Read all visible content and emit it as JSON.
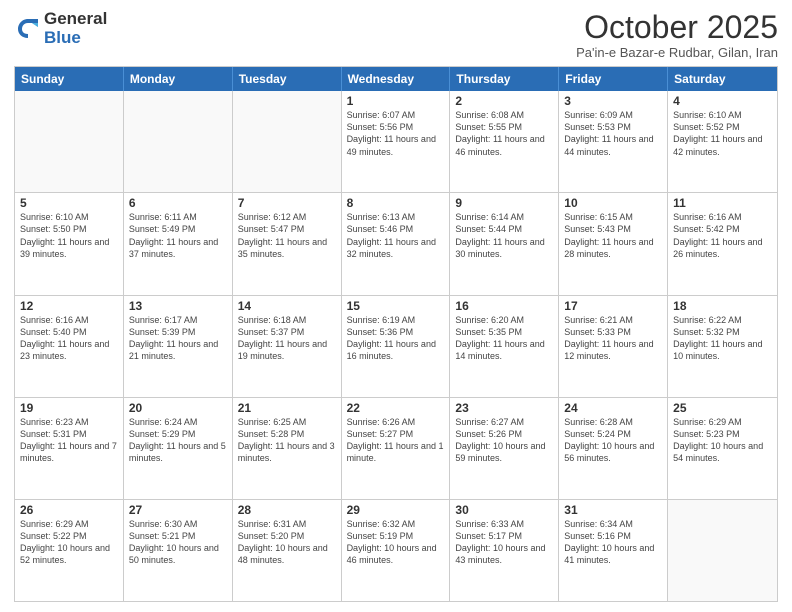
{
  "logo": {
    "general": "General",
    "blue": "Blue"
  },
  "header": {
    "month": "October 2025",
    "location": "Pa'in-e Bazar-e Rudbar, Gilan, Iran"
  },
  "weekdays": [
    "Sunday",
    "Monday",
    "Tuesday",
    "Wednesday",
    "Thursday",
    "Friday",
    "Saturday"
  ],
  "rows": [
    [
      {
        "day": "",
        "info": ""
      },
      {
        "day": "",
        "info": ""
      },
      {
        "day": "",
        "info": ""
      },
      {
        "day": "1",
        "info": "Sunrise: 6:07 AM\nSunset: 5:56 PM\nDaylight: 11 hours and 49 minutes."
      },
      {
        "day": "2",
        "info": "Sunrise: 6:08 AM\nSunset: 5:55 PM\nDaylight: 11 hours and 46 minutes."
      },
      {
        "day": "3",
        "info": "Sunrise: 6:09 AM\nSunset: 5:53 PM\nDaylight: 11 hours and 44 minutes."
      },
      {
        "day": "4",
        "info": "Sunrise: 6:10 AM\nSunset: 5:52 PM\nDaylight: 11 hours and 42 minutes."
      }
    ],
    [
      {
        "day": "5",
        "info": "Sunrise: 6:10 AM\nSunset: 5:50 PM\nDaylight: 11 hours and 39 minutes."
      },
      {
        "day": "6",
        "info": "Sunrise: 6:11 AM\nSunset: 5:49 PM\nDaylight: 11 hours and 37 minutes."
      },
      {
        "day": "7",
        "info": "Sunrise: 6:12 AM\nSunset: 5:47 PM\nDaylight: 11 hours and 35 minutes."
      },
      {
        "day": "8",
        "info": "Sunrise: 6:13 AM\nSunset: 5:46 PM\nDaylight: 11 hours and 32 minutes."
      },
      {
        "day": "9",
        "info": "Sunrise: 6:14 AM\nSunset: 5:44 PM\nDaylight: 11 hours and 30 minutes."
      },
      {
        "day": "10",
        "info": "Sunrise: 6:15 AM\nSunset: 5:43 PM\nDaylight: 11 hours and 28 minutes."
      },
      {
        "day": "11",
        "info": "Sunrise: 6:16 AM\nSunset: 5:42 PM\nDaylight: 11 hours and 26 minutes."
      }
    ],
    [
      {
        "day": "12",
        "info": "Sunrise: 6:16 AM\nSunset: 5:40 PM\nDaylight: 11 hours and 23 minutes."
      },
      {
        "day": "13",
        "info": "Sunrise: 6:17 AM\nSunset: 5:39 PM\nDaylight: 11 hours and 21 minutes."
      },
      {
        "day": "14",
        "info": "Sunrise: 6:18 AM\nSunset: 5:37 PM\nDaylight: 11 hours and 19 minutes."
      },
      {
        "day": "15",
        "info": "Sunrise: 6:19 AM\nSunset: 5:36 PM\nDaylight: 11 hours and 16 minutes."
      },
      {
        "day": "16",
        "info": "Sunrise: 6:20 AM\nSunset: 5:35 PM\nDaylight: 11 hours and 14 minutes."
      },
      {
        "day": "17",
        "info": "Sunrise: 6:21 AM\nSunset: 5:33 PM\nDaylight: 11 hours and 12 minutes."
      },
      {
        "day": "18",
        "info": "Sunrise: 6:22 AM\nSunset: 5:32 PM\nDaylight: 11 hours and 10 minutes."
      }
    ],
    [
      {
        "day": "19",
        "info": "Sunrise: 6:23 AM\nSunset: 5:31 PM\nDaylight: 11 hours and 7 minutes."
      },
      {
        "day": "20",
        "info": "Sunrise: 6:24 AM\nSunset: 5:29 PM\nDaylight: 11 hours and 5 minutes."
      },
      {
        "day": "21",
        "info": "Sunrise: 6:25 AM\nSunset: 5:28 PM\nDaylight: 11 hours and 3 minutes."
      },
      {
        "day": "22",
        "info": "Sunrise: 6:26 AM\nSunset: 5:27 PM\nDaylight: 11 hours and 1 minute."
      },
      {
        "day": "23",
        "info": "Sunrise: 6:27 AM\nSunset: 5:26 PM\nDaylight: 10 hours and 59 minutes."
      },
      {
        "day": "24",
        "info": "Sunrise: 6:28 AM\nSunset: 5:24 PM\nDaylight: 10 hours and 56 minutes."
      },
      {
        "day": "25",
        "info": "Sunrise: 6:29 AM\nSunset: 5:23 PM\nDaylight: 10 hours and 54 minutes."
      }
    ],
    [
      {
        "day": "26",
        "info": "Sunrise: 6:29 AM\nSunset: 5:22 PM\nDaylight: 10 hours and 52 minutes."
      },
      {
        "day": "27",
        "info": "Sunrise: 6:30 AM\nSunset: 5:21 PM\nDaylight: 10 hours and 50 minutes."
      },
      {
        "day": "28",
        "info": "Sunrise: 6:31 AM\nSunset: 5:20 PM\nDaylight: 10 hours and 48 minutes."
      },
      {
        "day": "29",
        "info": "Sunrise: 6:32 AM\nSunset: 5:19 PM\nDaylight: 10 hours and 46 minutes."
      },
      {
        "day": "30",
        "info": "Sunrise: 6:33 AM\nSunset: 5:17 PM\nDaylight: 10 hours and 43 minutes."
      },
      {
        "day": "31",
        "info": "Sunrise: 6:34 AM\nSunset: 5:16 PM\nDaylight: 10 hours and 41 minutes."
      },
      {
        "day": "",
        "info": ""
      }
    ]
  ]
}
